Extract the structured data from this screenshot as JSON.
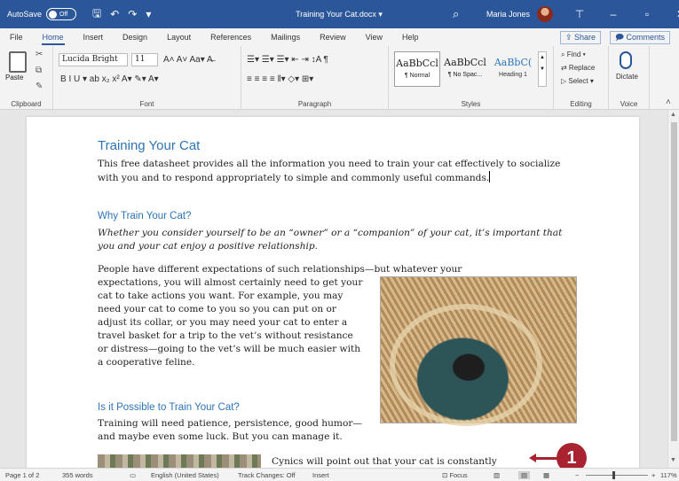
{
  "titlebar": {
    "autosave_label": "AutoSave",
    "autosave_state": "Off",
    "doc_title": "Training Your Cat.docx ▾",
    "user_name": "Maria Jones",
    "qat_save": "🖫",
    "qat_undo": "↶",
    "qat_redo": "↷",
    "qat_more": "▾",
    "search_icon": "⌕",
    "ribbon_display": "⊤",
    "minimize": "–",
    "maximize": "▫",
    "close": "✕"
  },
  "tabs": [
    "File",
    "Home",
    "Insert",
    "Design",
    "Layout",
    "References",
    "Mailings",
    "Review",
    "View",
    "Help"
  ],
  "share_label": "⇪ Share",
  "comments_label": "🗩 Comments",
  "ribbon": {
    "clipboard": {
      "paste": "Paste",
      "label": "Clipboard"
    },
    "font": {
      "name": "Lucida Bright",
      "size": "11",
      "label": "Font",
      "row1": "A˄  A˅  Aa▾  A̶",
      "row2": "B  I  U ▾  ab  x₂  x²  A▾  ✎▾  A▾"
    },
    "paragraph": {
      "label": "Paragraph",
      "row1": "☰▾  ☰▾  ☰▾  ⇤  ⇥  ↕A  ¶",
      "row2": "≡  ≡  ≡  ≡  ‖▾  ◇▾  ⊞▾"
    },
    "styles": {
      "label": "Styles",
      "items": [
        {
          "sample": "AaBbCcl",
          "name": "¶ Normal"
        },
        {
          "sample": "AaBbCcl",
          "name": "¶ No Spac..."
        },
        {
          "sample": "AaBbC(",
          "name": "Heading 1"
        }
      ]
    },
    "editing": {
      "label": "Editing",
      "find": "⌕ Find ▾",
      "replace": "⇄ Replace",
      "select": "▷ Select ▾"
    },
    "voice": {
      "label": "Voice",
      "dictate": "Dictate"
    }
  },
  "document": {
    "title": "Training Your Cat",
    "intro": "This free datasheet provides all the information you need to train your cat effectively to socialize with you and to respond appropriately to simple and commonly useful commands.",
    "h2_why": "Why Train Your Cat?",
    "why_text": "Whether you consider yourself to be an “owner” or a “companion” of your cat, it’s important that you and your cat enjoy a positive relationship.",
    "para_line1": "People have different expectations of such relationships—but whatever your",
    "para_rest": "expectations, you will almost certainly need to get your cat to take actions you want. For example, you may need your cat to come to you so you can put on or adjust its collar, or you may need your cat to enter a travel basket for a trip to the vet’s without resistance or distress—going to the vet’s will be much easier with a cooperative feline.",
    "h2_possible": "Is it Possible to Train Your Cat?",
    "possible_text": "Training will need patience, persistence, good humor—and maybe even some luck. But you can manage it.",
    "cynics": "Cynics will point out that your cat is constantly"
  },
  "callout": "1",
  "statusbar": {
    "page": "Page 1 of 2",
    "words": "355 words",
    "language": "English (United States)",
    "track": "Track Changes: Off",
    "mode": "Insert",
    "focus": "Focus",
    "zoom": "117%",
    "zoom_minus": "−",
    "zoom_plus": "+"
  }
}
